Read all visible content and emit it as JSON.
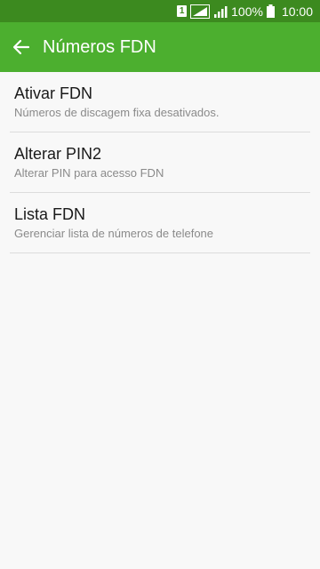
{
  "status_bar": {
    "sim_label": "1",
    "battery_text": "100%",
    "time": "10:00",
    "icons": [
      "sim-icon",
      "wifi-icon",
      "signal-icon",
      "battery-icon"
    ]
  },
  "app_bar": {
    "title": "Números FDN",
    "back_icon": "arrow-left-icon",
    "color": "#4caf2f",
    "status_color": "#3c8a1f"
  },
  "items": [
    {
      "title": "Ativar FDN",
      "subtitle": "Números de discagem fixa desativados."
    },
    {
      "title": "Alterar PIN2",
      "subtitle": "Alterar PIN para acesso FDN"
    },
    {
      "title": "Lista FDN",
      "subtitle": "Gerenciar lista de números de telefone"
    }
  ]
}
